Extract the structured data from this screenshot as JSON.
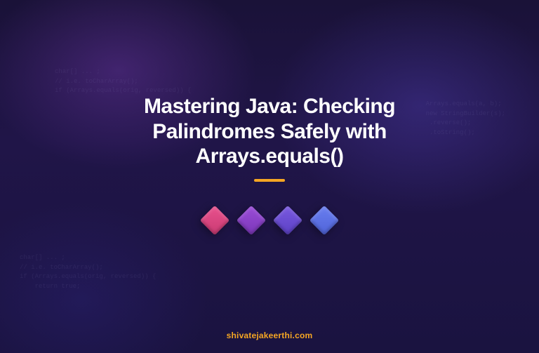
{
  "title": "Mastering Java: Checking Palindromes Safely with Arrays.equals()",
  "footer": "shivatejakeerthi.com",
  "accent_underline_color": "#f5a623",
  "diamonds": [
    {
      "color_top": "#e9528e",
      "color_bottom": "#c93a72"
    },
    {
      "color_top": "#9b4dd8",
      "color_bottom": "#7a36b8"
    },
    {
      "color_top": "#7a5ae0",
      "color_bottom": "#5b40c4"
    },
    {
      "color_top": "#6a7ff0",
      "color_bottom": "#4f63d8"
    }
  ],
  "code_snippets": {
    "top": "char[] ... ;\n// i.e. toCharArray();\nif (Arrays.equals(orig, reversed)) {",
    "right": "Arrays.equals(a, b);\nnew StringBuilder(s);\n .reverse();\n .toString();",
    "bottom": "char[] ... ;\n// i.e. toCharArray();\nif (Arrays.equals(orig, reversed)) {\n    return true;"
  }
}
